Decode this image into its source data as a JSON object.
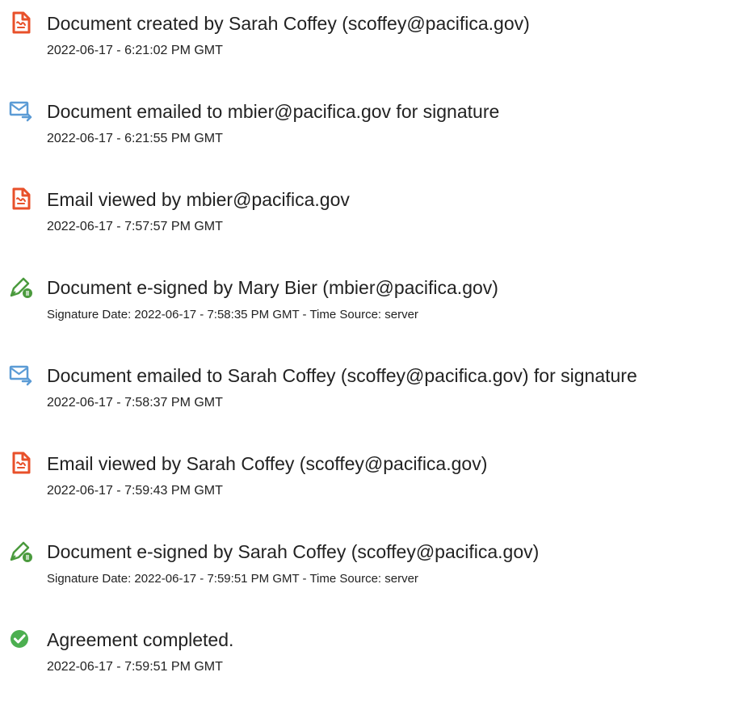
{
  "events": [
    {
      "icon": "document-created-icon",
      "title": "Document created by Sarah Coffey (scoffey@pacifica.gov)",
      "detail": "2022-06-17 - 6:21:02 PM GMT"
    },
    {
      "icon": "email-sent-icon",
      "title": "Document emailed to mbier@pacifica.gov for signature",
      "detail": "2022-06-17 - 6:21:55 PM GMT"
    },
    {
      "icon": "document-viewed-icon",
      "title": "Email viewed by mbier@pacifica.gov",
      "detail": "2022-06-17 - 7:57:57 PM GMT"
    },
    {
      "icon": "esign-pen-icon",
      "title": "Document e-signed by Mary Bier (mbier@pacifica.gov)",
      "detail": "Signature Date: 2022-06-17 - 7:58:35 PM GMT - Time Source: server"
    },
    {
      "icon": "email-sent-icon",
      "title": "Document emailed to Sarah Coffey (scoffey@pacifica.gov) for signature",
      "detail": "2022-06-17 - 7:58:37 PM GMT"
    },
    {
      "icon": "document-viewed-icon",
      "title": "Email viewed by Sarah Coffey (scoffey@pacifica.gov)",
      "detail": "2022-06-17 - 7:59:43 PM GMT"
    },
    {
      "icon": "esign-pen-icon",
      "title": "Document e-signed by Sarah Coffey (scoffey@pacifica.gov)",
      "detail": "Signature Date: 2022-06-17 - 7:59:51 PM GMT - Time Source: server"
    },
    {
      "icon": "checkmark-circle-icon",
      "title": "Agreement completed.",
      "detail": "2022-06-17 - 7:59:51 PM GMT"
    }
  ],
  "colors": {
    "document_icon": "#e8502a",
    "email_icon": "#5b9bd5",
    "pen_icon": "#4a9a3d",
    "complete_icon": "#4caf50",
    "text": "#222222"
  }
}
